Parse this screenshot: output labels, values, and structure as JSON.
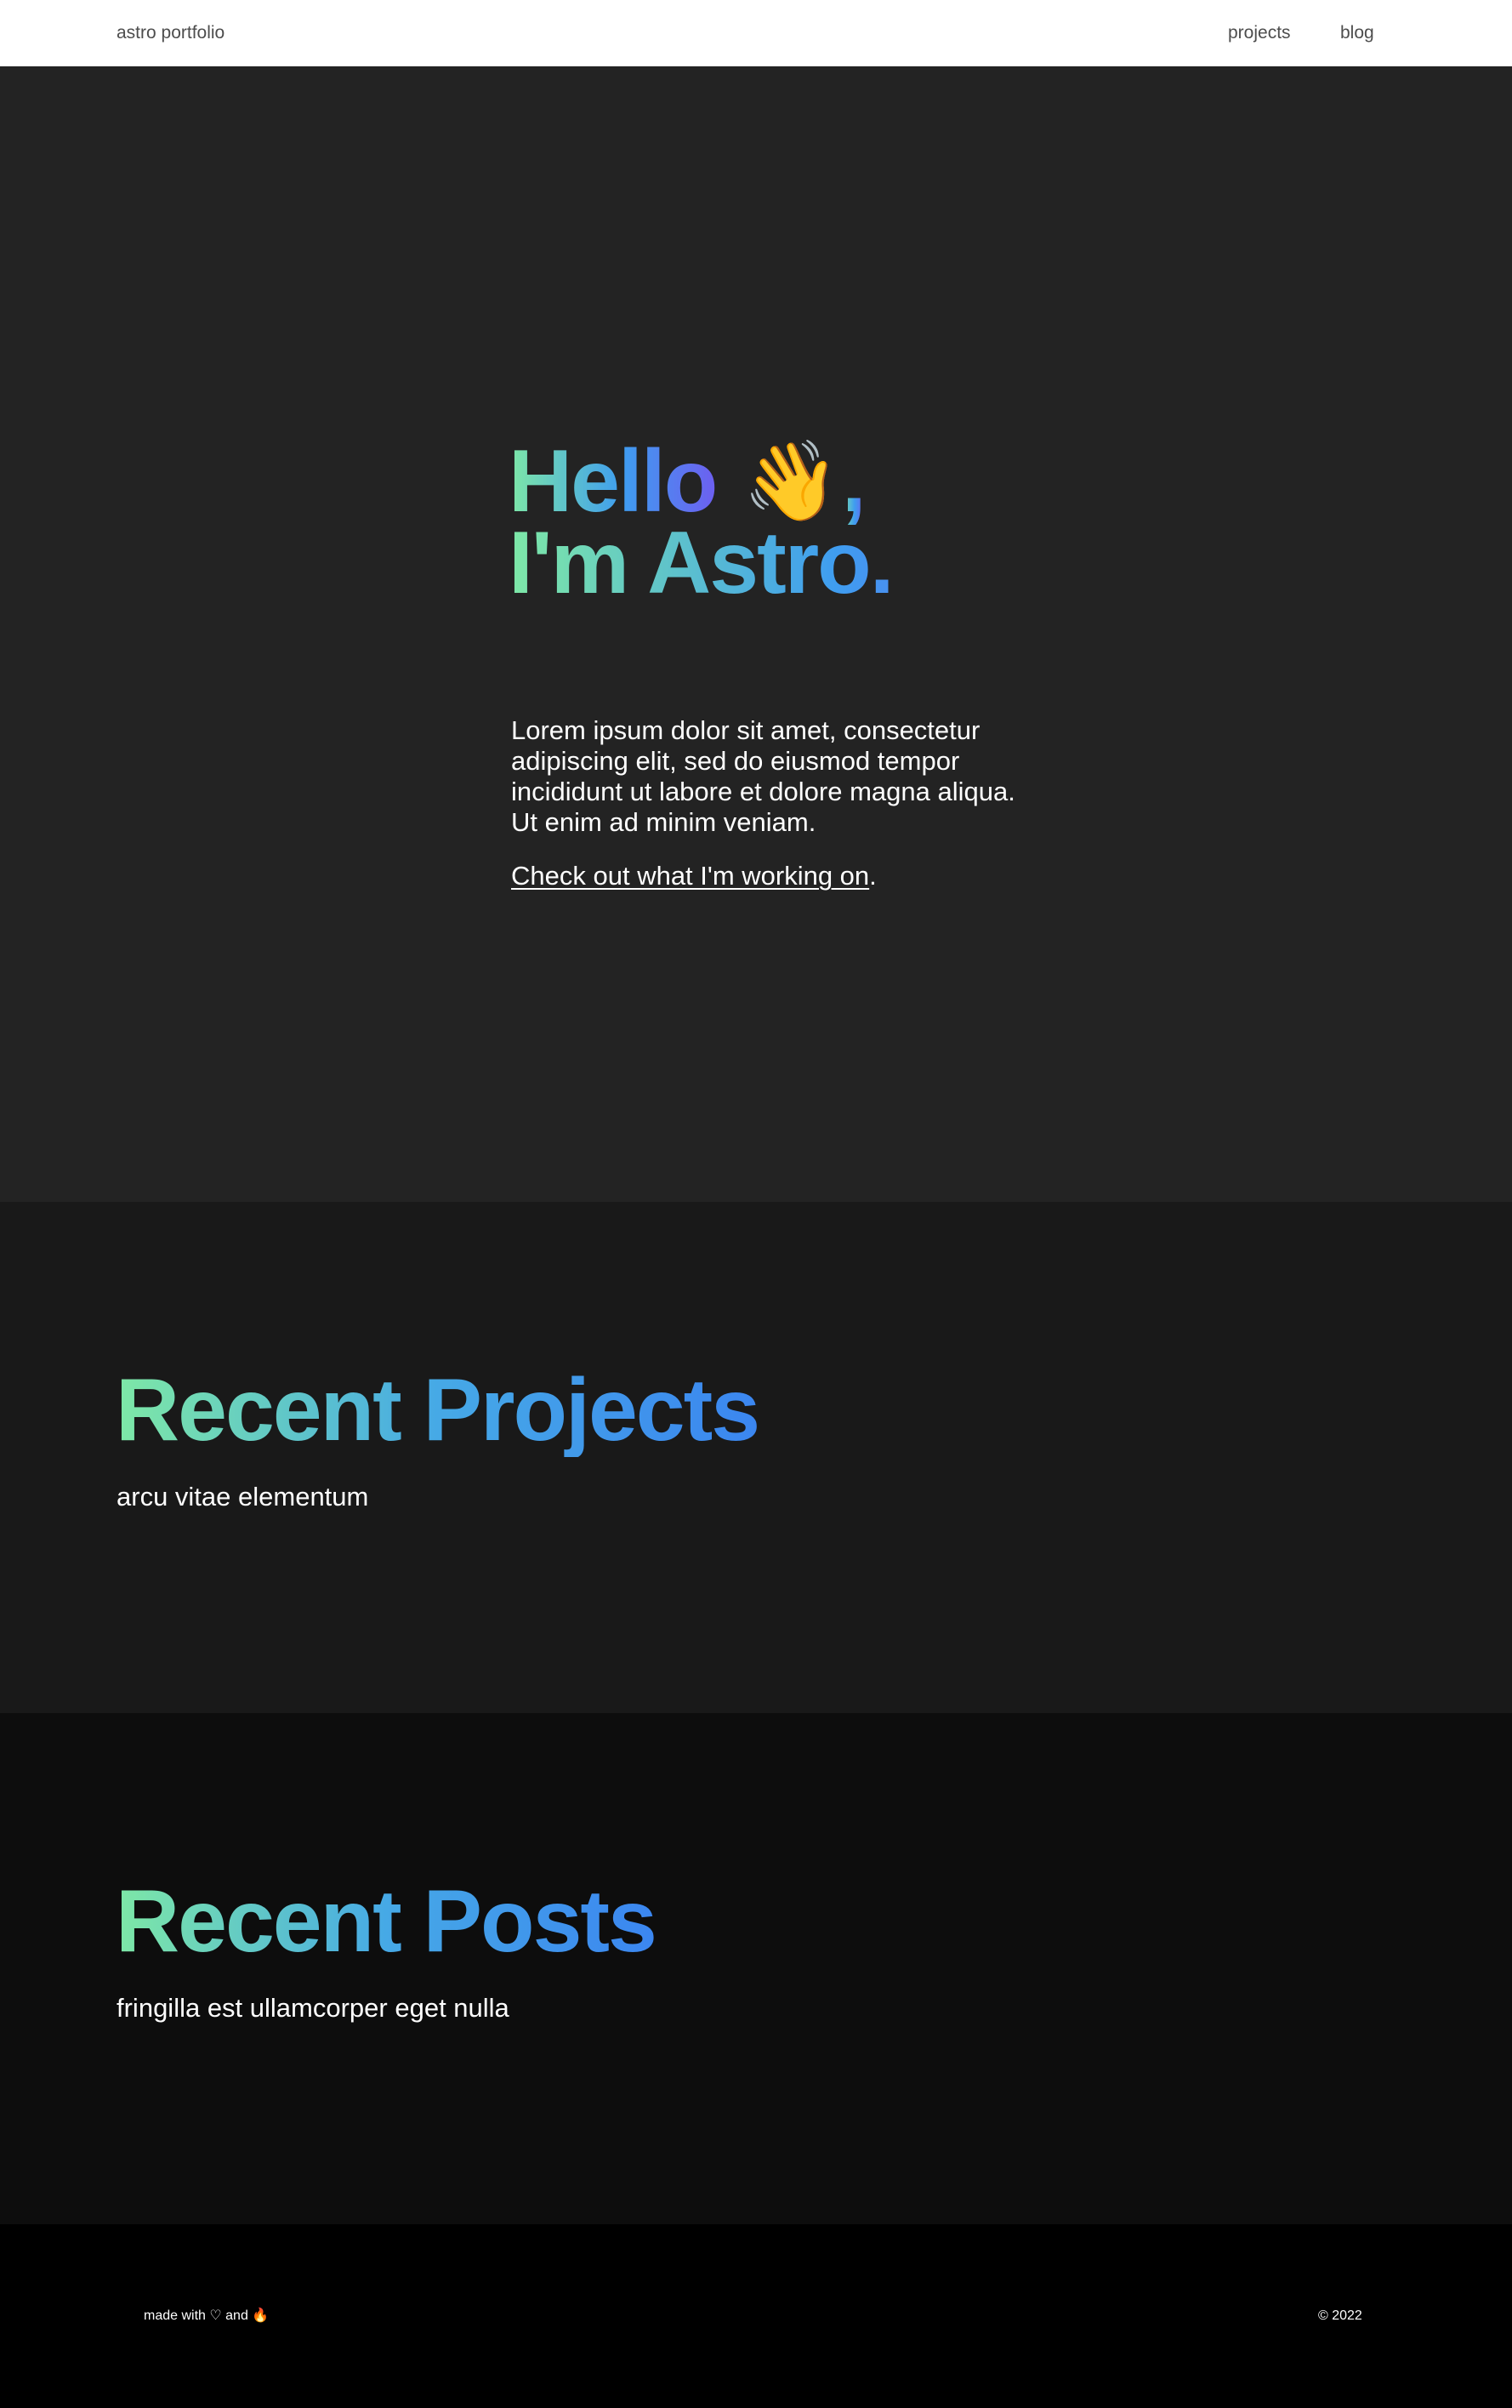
{
  "header": {
    "brand": "astro portfolio",
    "nav": {
      "projects": "projects",
      "blog": "blog"
    }
  },
  "hero": {
    "title_line1_text": "Hello",
    "title_line1_emoji": "👋",
    "title_line1_end": ",",
    "title_line2": "I'm Astro.",
    "body": "Lorem ipsum dolor sit amet, consectetur adipiscing elit, sed do eiusmod tempor incididunt ut labore et dolore magna aliqua. Ut enim ad minim veniam.",
    "cta_link": "Check out what I'm working on",
    "cta_suffix": "."
  },
  "projects": {
    "title": "Recent Projects",
    "subtitle": "arcu vitae elementum"
  },
  "posts": {
    "title": "Recent Posts",
    "subtitle": "fringilla est ullamcorper eget nulla"
  },
  "footer": {
    "made_with": "made with ♡ and 🔥",
    "copyright": "© 2022"
  },
  "colors": {
    "header_bg": "#ffffff",
    "hero_bg": "#232323",
    "projects_bg": "#191919",
    "posts_bg": "#0d0d0d",
    "footer_bg": "#000000",
    "gradient_start": "#7ee8a6",
    "gradient_mid": "#3f9df0",
    "gradient_end": "#6d5ff0"
  }
}
